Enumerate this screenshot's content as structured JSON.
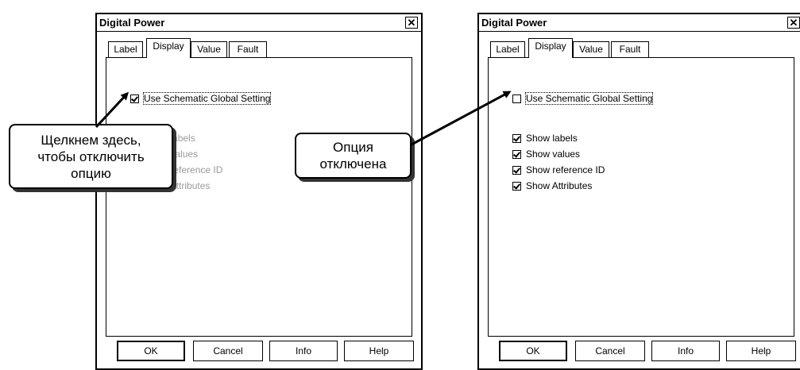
{
  "left_dialog": {
    "title": "Digital Power",
    "close_symbol": "✕",
    "tabs": [
      "Label",
      "Display",
      "Value",
      "Fault"
    ],
    "active_tab": "Display",
    "global_setting": {
      "label": "Use Schematic Global Setting",
      "checked": true
    },
    "options": [
      {
        "label": "Show labels",
        "checked": true,
        "enabled": false
      },
      {
        "label": "Show values",
        "checked": true,
        "enabled": false
      },
      {
        "label": "Show reference ID",
        "checked": true,
        "enabled": false
      },
      {
        "label": "Show Attributes",
        "checked": true,
        "enabled": false
      }
    ],
    "buttons": [
      "OK",
      "Cancel",
      "Info",
      "Help"
    ]
  },
  "right_dialog": {
    "title": "Digital Power",
    "close_symbol": "✕",
    "tabs": [
      "Label",
      "Display",
      "Value",
      "Fault"
    ],
    "active_tab": "Display",
    "global_setting": {
      "label": "Use Schematic Global Setting",
      "checked": false
    },
    "options": [
      {
        "label": "Show labels",
        "checked": true,
        "enabled": true
      },
      {
        "label": "Show values",
        "checked": true,
        "enabled": true
      },
      {
        "label": "Show reference ID",
        "checked": true,
        "enabled": true
      },
      {
        "label": "Show Attributes",
        "checked": true,
        "enabled": true
      }
    ],
    "buttons": [
      "OK",
      "Cancel",
      "Info",
      "Help"
    ]
  },
  "callouts": {
    "click_here": "Щелкнем здесь,\nчтобы отключить\nопцию",
    "option_disabled": "Опция\nотключена"
  }
}
